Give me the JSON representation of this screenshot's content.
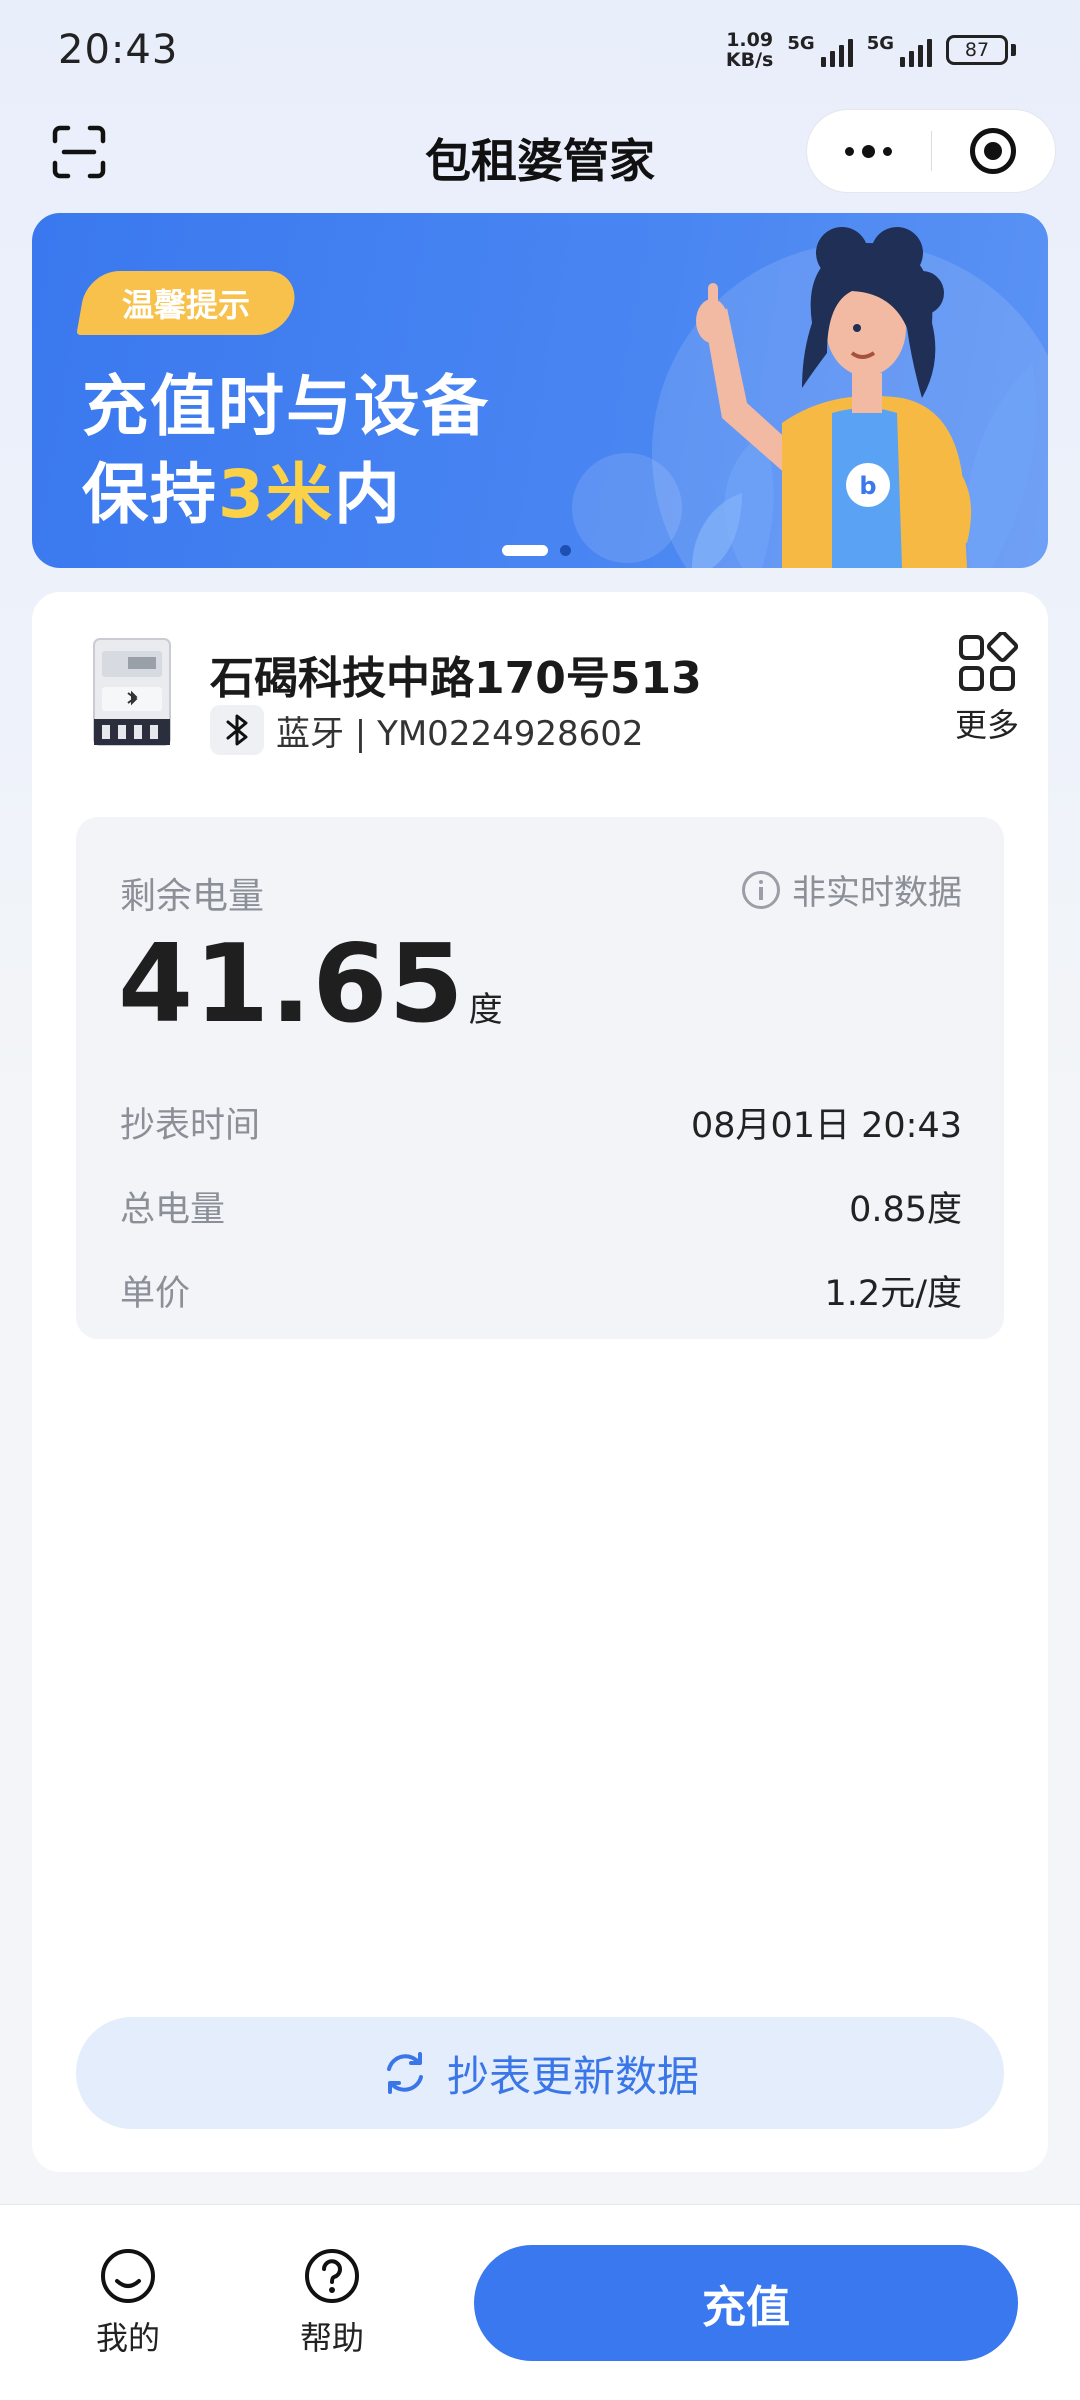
{
  "status_bar": {
    "time": "20:43",
    "net_speed_value": "1.09",
    "net_speed_unit": "KB/s",
    "signal1_label": "5G",
    "signal2_label": "5G",
    "battery": "87"
  },
  "nav": {
    "title": "包租婆管家",
    "left_icon": "scan-icon",
    "menu_icon": "more-dots-icon",
    "close_icon": "target-icon"
  },
  "banner": {
    "tag": "温馨提示",
    "line1": "充值时与设备",
    "line2_prefix": "保持",
    "line2_highlight": "3米",
    "line2_suffix": "内",
    "active_slide": 1,
    "slide_count": 2,
    "colors": {
      "background": "#3a78ef",
      "tag": "#f7c14b",
      "highlight": "#fbd148"
    }
  },
  "device": {
    "name": "石碣科技中路170号513",
    "connection": "蓝牙",
    "separator": " | ",
    "meter_id": "YM0224928602",
    "more_label": "更多"
  },
  "info": {
    "remain_label": "剩余电量",
    "realtime_note": "非实时数据",
    "remain_value": "41.65",
    "remain_unit": "度",
    "rows": [
      {
        "key": "抄表时间",
        "value": "08月01日 20:43"
      },
      {
        "key": "总电量",
        "value": "0.85度"
      },
      {
        "key": "单价",
        "value": "1.2元/度"
      }
    ]
  },
  "actions": {
    "refresh_label": "抄表更新数据"
  },
  "bottom": {
    "tab_me": "我的",
    "tab_help": "帮助",
    "pay_label": "充值",
    "accent_color": "#3a78ef"
  }
}
